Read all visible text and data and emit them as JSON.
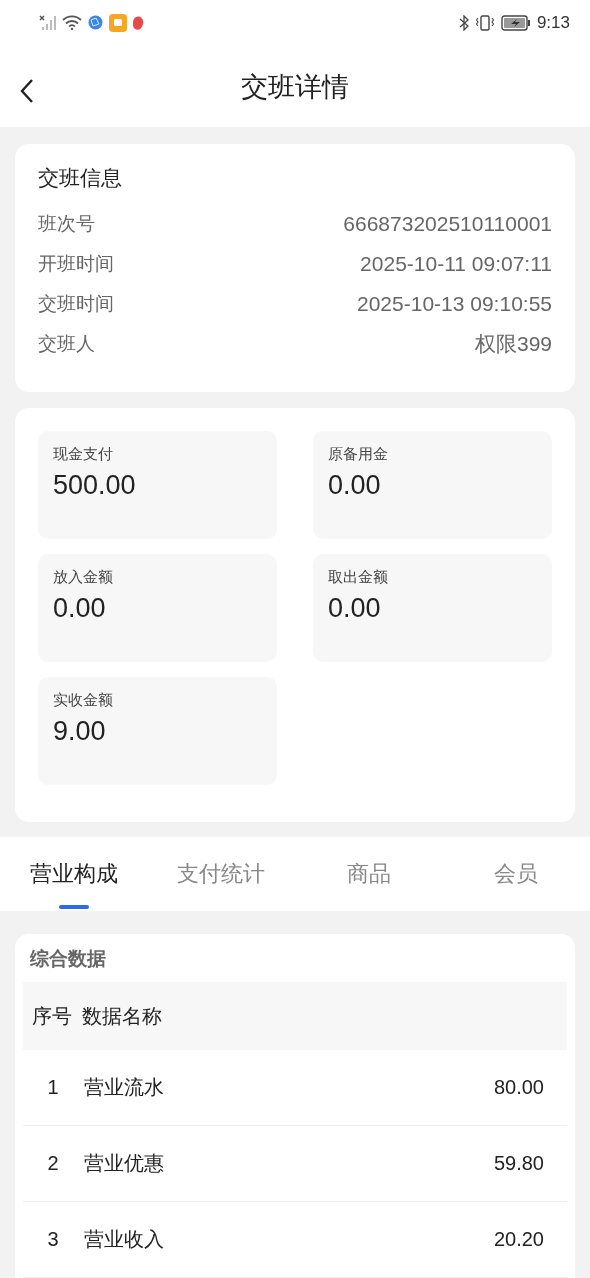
{
  "status_bar": {
    "time": "9:13"
  },
  "header": {
    "title": "交班详情"
  },
  "shift_info": {
    "title": "交班信息",
    "fields": [
      {
        "label": "班次号",
        "value": "666873202510110001"
      },
      {
        "label": "开班时间",
        "value": "2025-10-11 09:07:11"
      },
      {
        "label": "交班时间",
        "value": "2025-10-13 09:10:55"
      },
      {
        "label": "交班人",
        "value": "权限399"
      }
    ]
  },
  "amounts": [
    {
      "label": "现金支付",
      "value": "500.00"
    },
    {
      "label": "原备用金",
      "value": "0.00"
    },
    {
      "label": "放入金额",
      "value": "0.00"
    },
    {
      "label": "取出金额",
      "value": "0.00"
    },
    {
      "label": "实收金额",
      "value": "9.00"
    }
  ],
  "tabs": [
    {
      "label": "营业构成",
      "selected": true
    },
    {
      "label": "支付统计",
      "selected": false
    },
    {
      "label": "商品",
      "selected": false
    },
    {
      "label": "会员",
      "selected": false
    }
  ],
  "table": {
    "title": "综合数据",
    "columns": [
      "序号",
      "数据名称"
    ],
    "rows": [
      {
        "cells": [
          "1",
          "营业流水",
          "80.00"
        ]
      },
      {
        "cells": [
          "2",
          "营业优惠",
          "59.80"
        ]
      },
      {
        "cells": [
          "3",
          "营业收入",
          "20.20"
        ]
      }
    ]
  }
}
